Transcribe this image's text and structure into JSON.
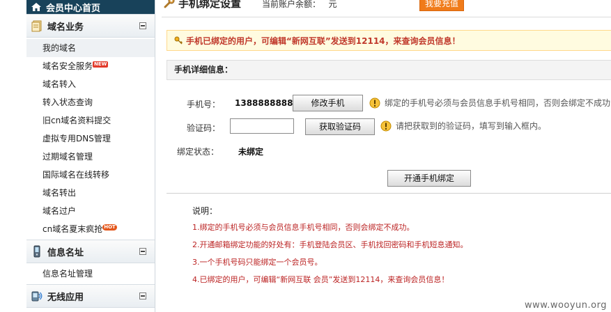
{
  "sidebar": {
    "home_label": "会员中心首页",
    "sections": [
      {
        "title": "域名业务",
        "icon": "document-stack-icon",
        "items": [
          {
            "label": "我的域名",
            "badge": ""
          },
          {
            "label": "域名安全服务",
            "badge": "NEW"
          },
          {
            "label": "域名转入",
            "badge": ""
          },
          {
            "label": "转入状态查询",
            "badge": ""
          },
          {
            "label": "旧cn域名资料提交",
            "badge": ""
          },
          {
            "label": "虚拟专用DNS管理",
            "badge": ""
          },
          {
            "label": "过期域名管理",
            "badge": ""
          },
          {
            "label": "国际域名在线转移",
            "badge": ""
          },
          {
            "label": "域名转出",
            "badge": ""
          },
          {
            "label": "域名过户",
            "badge": ""
          },
          {
            "label": "cn域名夏末疯抢",
            "badge": "HOT"
          }
        ]
      },
      {
        "title": "信息名址",
        "icon": "mobile-phone-icon",
        "items": [
          {
            "label": "信息名址管理",
            "badge": ""
          }
        ]
      },
      {
        "title": "无线应用",
        "icon": "wireless-icon",
        "items": []
      }
    ]
  },
  "header": {
    "title": "手机绑定设置",
    "balance_label": "当前账户余额：",
    "balance_unit": "元",
    "recharge_label": "我要充值"
  },
  "notice": "手机已绑定的用户，可编辑“新网互联”发送到12114，来查询会员信息！",
  "detail_header": "手机详细信息：",
  "form": {
    "phone_label": "手机号：",
    "phone_value": "13888888888",
    "change_phone_label": "修改手机",
    "phone_hint": "绑定的手机号必须与会员信息手机号相同，否则会绑定不成功",
    "code_label": "验证码：",
    "code_value": "",
    "get_code_label": "获取验证码",
    "code_hint": "请把获取到的验证码，填写到输入框内。",
    "status_label": "绑定状态：",
    "status_value": "未绑定",
    "submit_label": "开通手机绑定"
  },
  "explanation": {
    "title": "说明：",
    "lines": [
      "1.绑定的手机号必须与会员信息手机号相同，否则会绑定不成功。",
      "2.开通邮箱绑定功能的好处有：手机登陆会员区、手机找回密码和手机短息通知。",
      "3.一个手机号码只能绑定一个会员号。",
      "4.已绑定的用户，可编辑“新网互联 会员”发送到12114，来查询会员信息！"
    ]
  },
  "watermark": "www.wooyun.org",
  "colors": {
    "sidebar_header": "#18425a",
    "recharge": "#f07b1a",
    "notice_text": "#c0392b",
    "explanation_text": "#bb2222",
    "warning_icon": "#f2b01e"
  }
}
